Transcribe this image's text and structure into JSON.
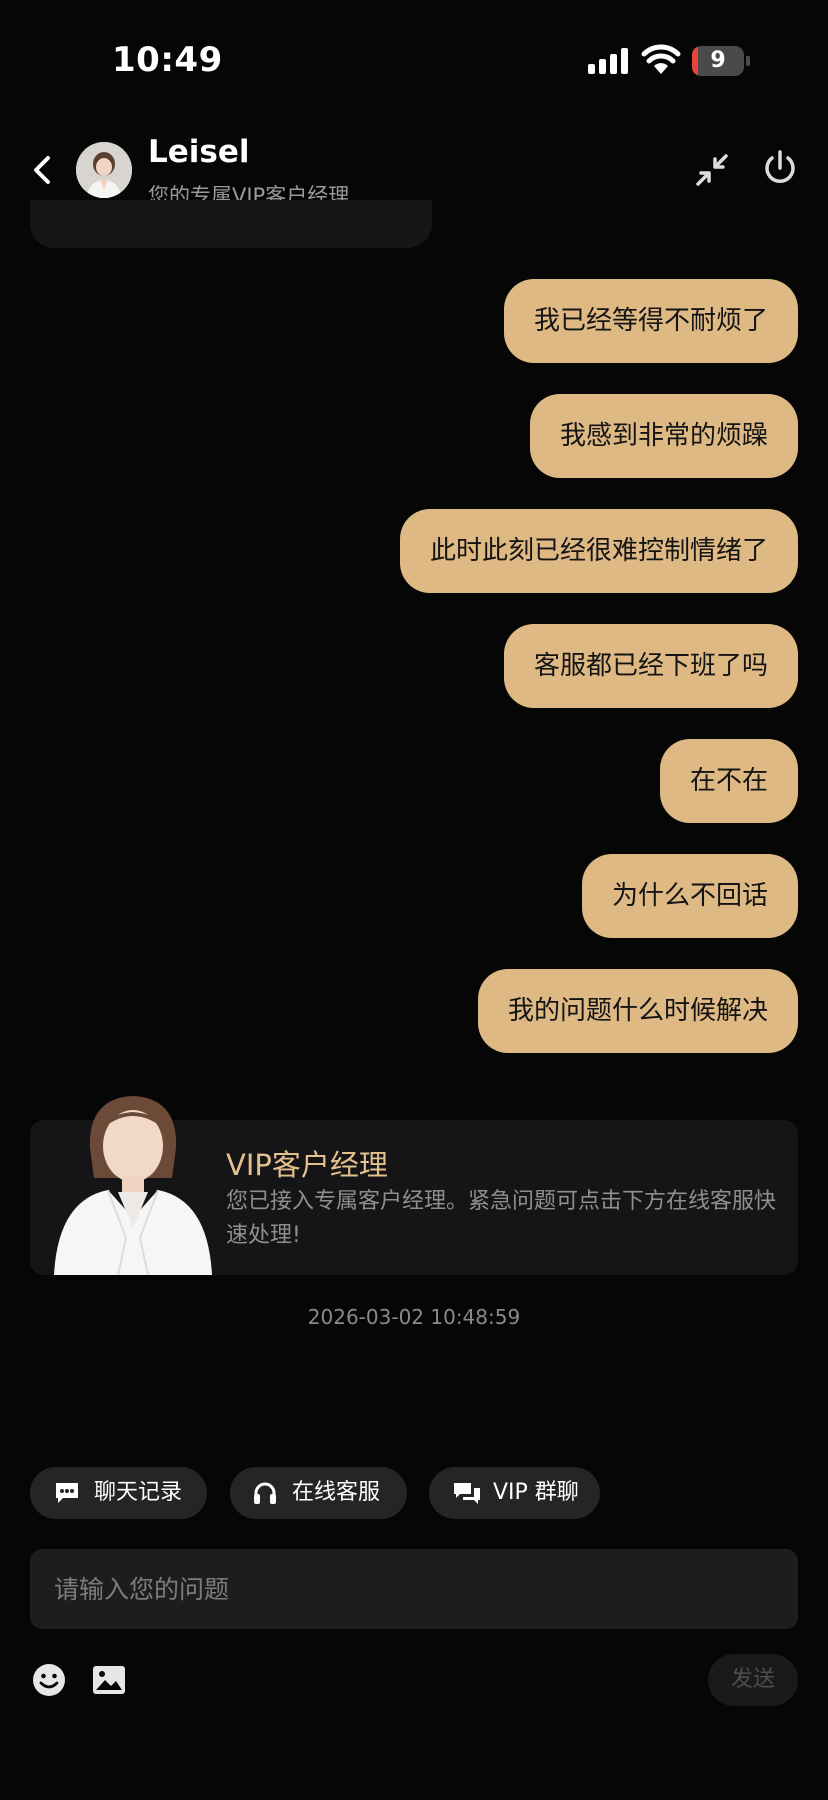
{
  "status_bar": {
    "time": "10:49",
    "battery": "9"
  },
  "header": {
    "name": "Leisel",
    "subtitle": "您的专属VIP客户经理"
  },
  "messages": [
    {
      "text": "我已经等得不耐烦了"
    },
    {
      "text": "我感到非常的烦躁"
    },
    {
      "text": "此时此刻已经很难控制情绪了"
    },
    {
      "text": "客服都已经下班了吗"
    },
    {
      "text": "在不在"
    },
    {
      "text": "为什么不回话"
    },
    {
      "text": "我的问题什么时候解决"
    }
  ],
  "vip_card": {
    "title": "VIP客户经理",
    "description": "您已接入专属客户经理。紧急问题可点击下方在线客服快速处理!"
  },
  "timestamp": "2026-03-02 10:48:59",
  "quick_actions": [
    {
      "label": "聊天记录",
      "icon": "chat-bubble-icon"
    },
    {
      "label": "在线客服",
      "icon": "headset-icon"
    },
    {
      "label": "VIP 群聊",
      "icon": "group-chat-icon"
    }
  ],
  "input": {
    "placeholder": "请输入您的问题",
    "value": ""
  },
  "composer": {
    "send_label": "发送"
  },
  "colors": {
    "bubble": "#deb983",
    "vip_title": "#e4c08d",
    "background": "#060606",
    "battery_low": "#e8443a"
  }
}
